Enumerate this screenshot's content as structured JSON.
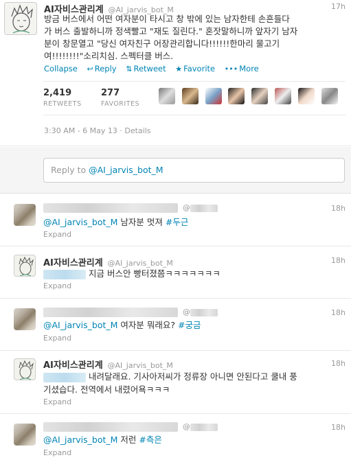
{
  "main_tweet": {
    "fullname": "AI자비스관리계",
    "screen_name": "@AI_jarvis_bot_M",
    "time": "17h",
    "text_lines": [
      "방금 버스에서 어떤 여자분이 타시고 창 밖에 있는 남자한테 손흔들다",
      "가 버스 출발하니까 정색빨고 \"재도 질린다.\" 혼잣말하니까 앞자기 남자",
      "분이 창문열고 \"당신 여자친구 어장관리합니다!!!!!!한마리 물고기",
      "여!!!!!!!!\"소리치심. 스펙터클 버스."
    ],
    "actions": {
      "collapse": "Collapse",
      "reply": "Reply",
      "retweet": "Retweet",
      "favorite": "Favorite",
      "more": "More"
    },
    "retweets": {
      "count": "2,419",
      "label": "RETWEETS"
    },
    "favorites": {
      "count": "277",
      "label": "FAVORITES"
    },
    "meta": "3:30 AM - 6 May 13 · Details"
  },
  "reply_box": {
    "prefix": "Reply to ",
    "handle": "@AI_jarvis_bot_M"
  },
  "replies": [
    {
      "screen_name": "@",
      "time": "18h",
      "mention": "@AI_jarvis_bot_M",
      "text": " 남자분 멋져 ",
      "hashtag": "#두근",
      "expand": "Expand"
    },
    {
      "fullname": "AI자비스관리계",
      "screen_name": "@AI_jarvis_bot_M",
      "time": "18h",
      "text": "지금 버스안 빵터졌쯤ㅋㅋㅋㅋㅋㅋㅋ",
      "expand": "Expand"
    },
    {
      "screen_name": "@",
      "time": "18h",
      "mention": "@AI_jarvis_bot_M",
      "text": " 여자분 뭐래요? ",
      "hashtag": "#궁금",
      "expand": "Expand"
    },
    {
      "fullname": "AI자비스관리계",
      "screen_name": "@AI_jarvis_bot_M",
      "time": "18h",
      "text_line1": "내려달래요. 기사아저씨가 정류장 아니면 안된다고 쿨내 풍",
      "text_line2": "기셨습다. 전역에서 내렸어욕ㅋㅋㅋ",
      "expand": "Expand"
    },
    {
      "screen_name": "@",
      "time": "18h",
      "mention": "@AI_jarvis_bot_M",
      "text": " 저런 ",
      "hashtag": "#측은",
      "expand": "Expand"
    }
  ]
}
